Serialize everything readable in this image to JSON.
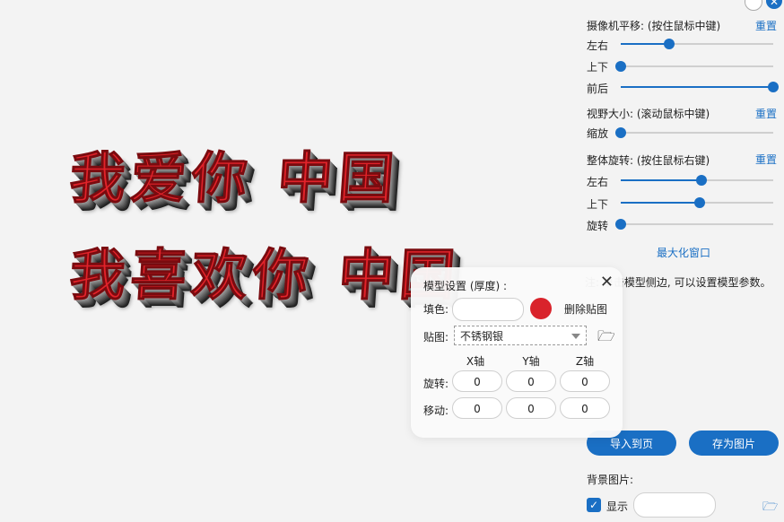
{
  "canvas": {
    "line1": "我爱你 中国",
    "line2": "我喜欢你 中国"
  },
  "panel": {
    "camera_pan": {
      "title": "摄像机平移: (按住鼠标中键)",
      "reset": "重置",
      "sliders": [
        {
          "label": "左右",
          "value": 0.32
        },
        {
          "label": "上下",
          "value": 0.0
        },
        {
          "label": "前后",
          "value": 1.0
        }
      ]
    },
    "fov": {
      "title": "视野大小: (滚动鼠标中键)",
      "reset": "重置",
      "sliders": [
        {
          "label": "缩放",
          "value": 0.0
        }
      ]
    },
    "rotation": {
      "title": "整体旋转: (按住鼠标右键)",
      "reset": "重置",
      "sliders": [
        {
          "label": "左右",
          "value": 0.53
        },
        {
          "label": "上下",
          "value": 0.52
        },
        {
          "label": "旋转",
          "value": 0.0
        }
      ]
    },
    "maximize": "最大化窗口",
    "note": "注: 单击模型侧边, 可以设置模型参数。",
    "import_button": "导入到页",
    "save_button": "存为图片",
    "bg_label": "背景图片:",
    "show_label": "显示"
  },
  "dialog": {
    "title": "模型设置 (厚度) :",
    "fill_label": "填色:",
    "fill_color": "#d9232b",
    "delete_texture": "删除贴图",
    "texture_label": "贴图:",
    "texture_value": "不锈钢银",
    "axes": [
      "X轴",
      "Y轴",
      "Z轴"
    ],
    "rotate_label": "旋转:",
    "move_label": "移动:",
    "rotate_values": [
      "0",
      "0",
      "0"
    ],
    "move_values": [
      "0",
      "0",
      "0"
    ]
  }
}
